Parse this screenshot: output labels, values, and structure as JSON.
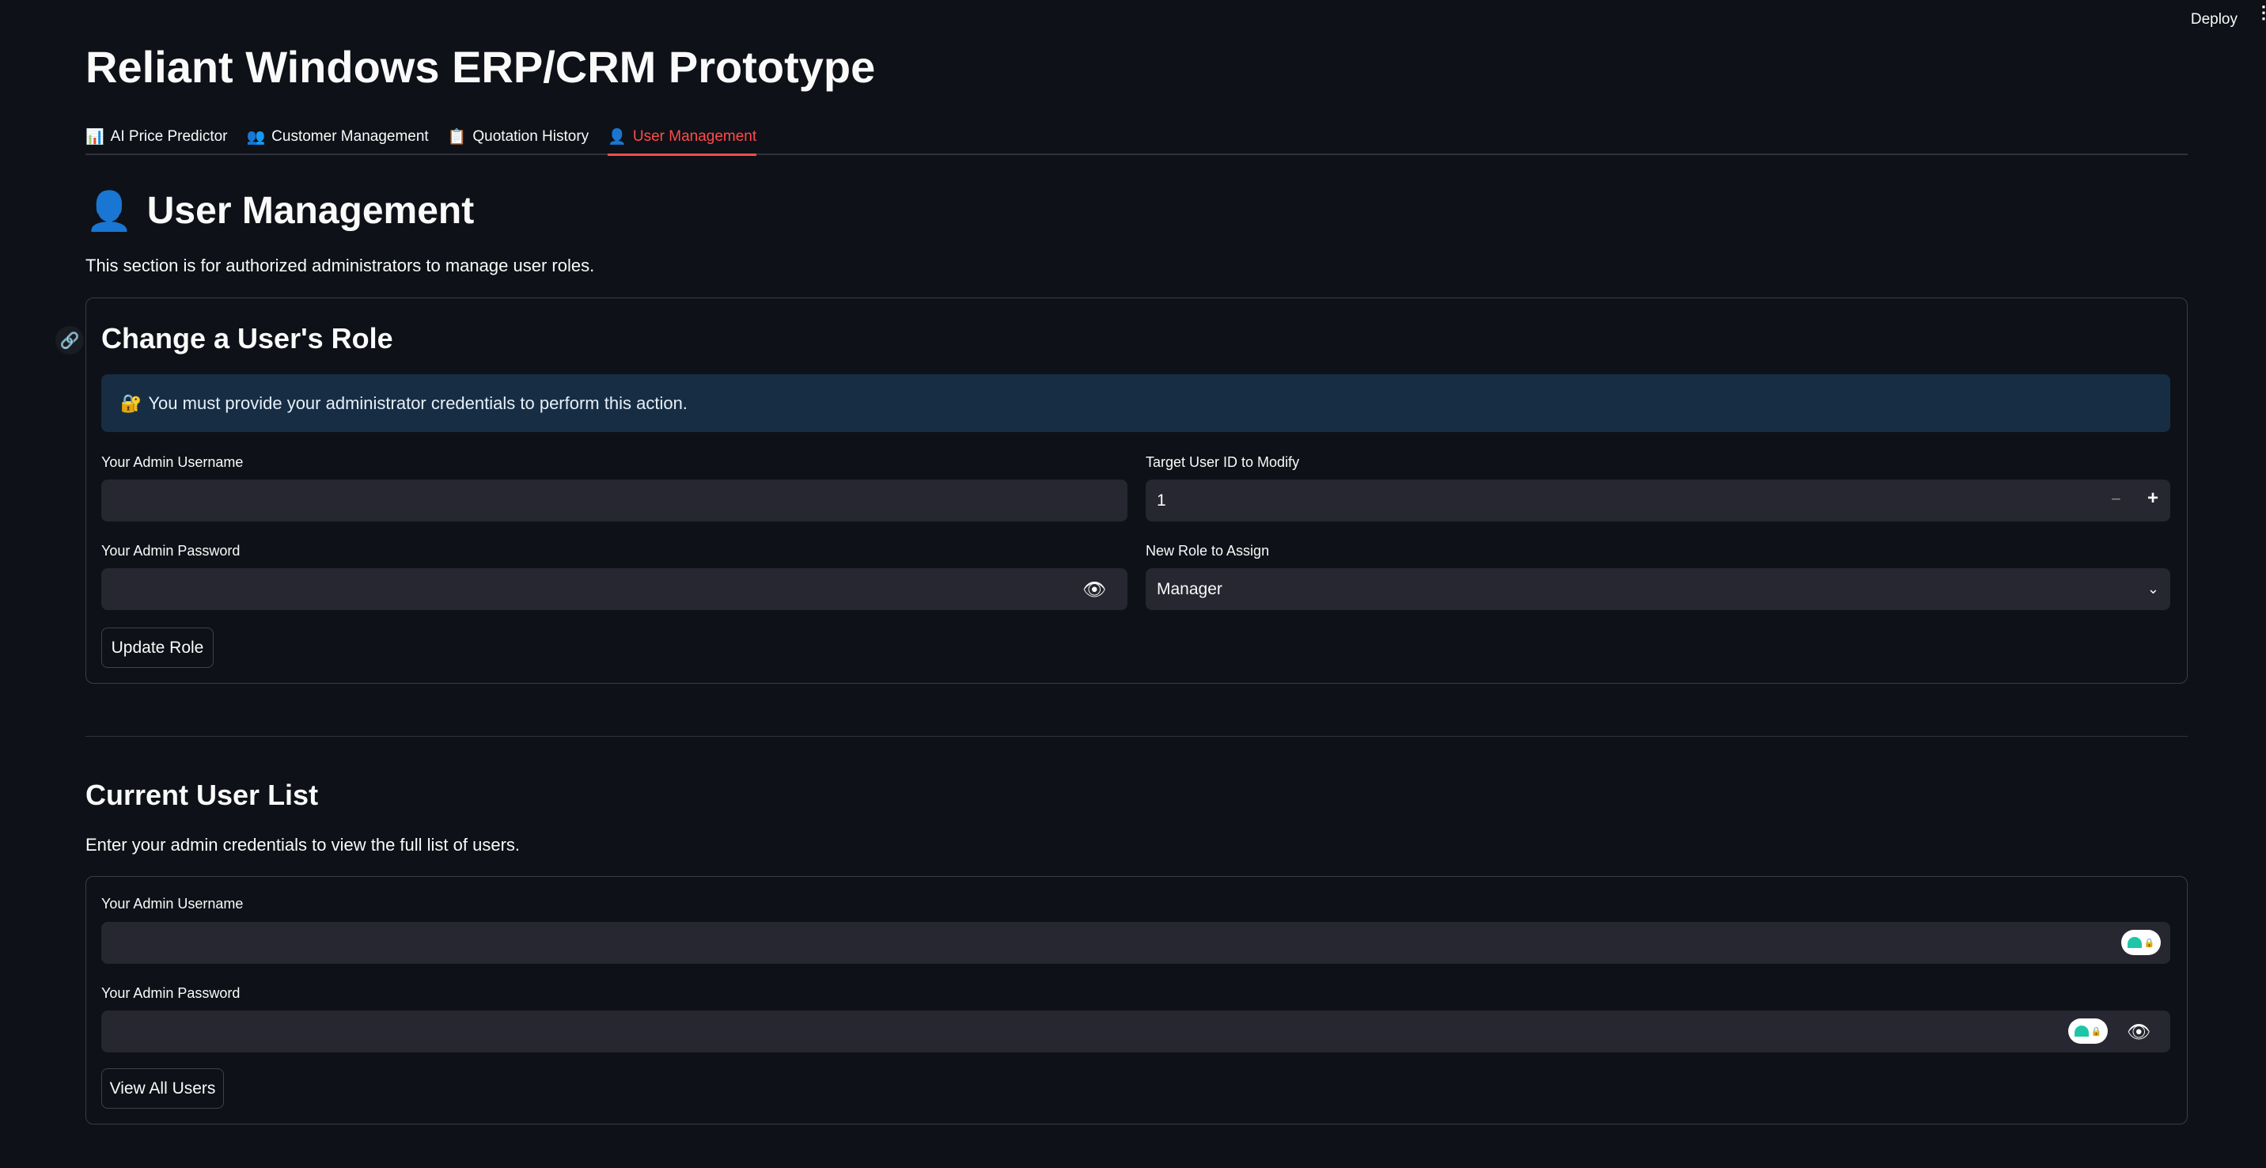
{
  "app": {
    "title": "Reliant Windows ERP/CRM Prototype",
    "deploy": "Deploy"
  },
  "tabs": [
    {
      "icon": "📊",
      "label": "AI Price Predictor"
    },
    {
      "icon": "👥",
      "label": "Customer Management"
    },
    {
      "icon": "📋",
      "label": "Quotation History"
    },
    {
      "icon": "👤",
      "label": "User Management",
      "active": true
    }
  ],
  "page": {
    "icon": "👤",
    "heading": "User Management",
    "description": "This section is for authorized administrators to manage user roles."
  },
  "change_role": {
    "heading": "Change a User's Role",
    "info_icon": "🔐",
    "info": "You must provide your administrator credentials to perform this action.",
    "username_label": "Your Admin Username",
    "username_value": "",
    "password_label": "Your Admin Password",
    "password_value": "",
    "target_label": "Target User ID to Modify",
    "target_value": "1",
    "minus": "−",
    "plus": "+",
    "role_label": "New Role to Assign",
    "role_value": "Manager",
    "button": "Update Role"
  },
  "user_list": {
    "heading": "Current User List",
    "description": "Enter your admin credentials to view the full list of users.",
    "username_label": "Your Admin Username",
    "username_value": "",
    "password_label": "Your Admin Password",
    "password_value": "",
    "button": "View All Users"
  },
  "colors": {
    "accent": "#ff4b4b",
    "info_bg": "#172d43",
    "input_bg": "#262730",
    "bg": "#0e1117"
  }
}
